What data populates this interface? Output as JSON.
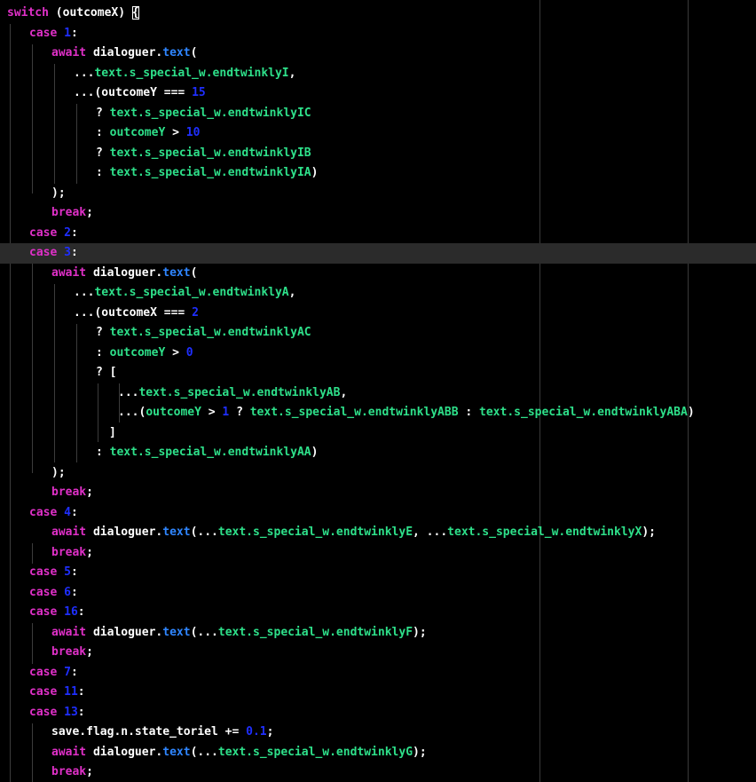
{
  "editor": {
    "current_line": 12,
    "lines": [
      {
        "indent": 0,
        "tokens": [
          {
            "t": "switch",
            "k": "kw"
          },
          {
            "t": " (outcomeX) ",
            "k": "id"
          },
          {
            "t": "{",
            "k": "op",
            "cursor": true
          }
        ]
      },
      {
        "indent": 1,
        "tokens": [
          {
            "t": "case ",
            "k": "kw"
          },
          {
            "t": "1",
            "k": "num"
          },
          {
            "t": ":",
            "k": "op"
          }
        ]
      },
      {
        "indent": 2,
        "tokens": [
          {
            "t": "await ",
            "k": "kw"
          },
          {
            "t": "dialoguer.",
            "k": "id"
          },
          {
            "t": "text",
            "k": "fn"
          },
          {
            "t": "(",
            "k": "op"
          }
        ]
      },
      {
        "indent": 3,
        "tokens": [
          {
            "t": "...",
            "k": "op"
          },
          {
            "t": "text.s_special_w.endtwinklyI",
            "k": "mem"
          },
          {
            "t": ",",
            "k": "op"
          }
        ]
      },
      {
        "indent": 3,
        "tokens": [
          {
            "t": "...(outcomeY === ",
            "k": "id"
          },
          {
            "t": "15",
            "k": "num"
          }
        ]
      },
      {
        "indent": 4,
        "tokens": [
          {
            "t": "? ",
            "k": "op"
          },
          {
            "t": "text.s_special_w.endtwinklyIC",
            "k": "mem"
          }
        ]
      },
      {
        "indent": 4,
        "tokens": [
          {
            "t": ": ",
            "k": "op"
          },
          {
            "t": "outcomeY",
            "k": "mem"
          },
          {
            "t": " > ",
            "k": "op"
          },
          {
            "t": "10",
            "k": "num"
          }
        ]
      },
      {
        "indent": 4,
        "tokens": [
          {
            "t": "? ",
            "k": "op"
          },
          {
            "t": "text.s_special_w.endtwinklyIB",
            "k": "mem"
          }
        ]
      },
      {
        "indent": 4,
        "tokens": [
          {
            "t": ": ",
            "k": "op"
          },
          {
            "t": "text.s_special_w.endtwinklyIA",
            "k": "mem"
          },
          {
            "t": ")",
            "k": "op"
          }
        ]
      },
      {
        "indent": 2,
        "tokens": [
          {
            "t": ");",
            "k": "op"
          }
        ]
      },
      {
        "indent": 2,
        "tokens": [
          {
            "t": "break",
            "k": "kw"
          },
          {
            "t": ";",
            "k": "op"
          }
        ]
      },
      {
        "indent": 1,
        "tokens": [
          {
            "t": "case ",
            "k": "kw"
          },
          {
            "t": "2",
            "k": "num"
          },
          {
            "t": ":",
            "k": "op"
          }
        ]
      },
      {
        "indent": 1,
        "tokens": [
          {
            "t": "case ",
            "k": "kw"
          },
          {
            "t": "3",
            "k": "num"
          },
          {
            "t": ":",
            "k": "op"
          }
        ]
      },
      {
        "indent": 2,
        "tokens": [
          {
            "t": "await ",
            "k": "kw"
          },
          {
            "t": "dialoguer.",
            "k": "id"
          },
          {
            "t": "text",
            "k": "fn"
          },
          {
            "t": "(",
            "k": "op"
          }
        ]
      },
      {
        "indent": 3,
        "tokens": [
          {
            "t": "...",
            "k": "op"
          },
          {
            "t": "text.s_special_w.endtwinklyA",
            "k": "mem"
          },
          {
            "t": ",",
            "k": "op"
          }
        ]
      },
      {
        "indent": 3,
        "tokens": [
          {
            "t": "...(outcomeX === ",
            "k": "id"
          },
          {
            "t": "2",
            "k": "num"
          }
        ]
      },
      {
        "indent": 4,
        "tokens": [
          {
            "t": "? ",
            "k": "op"
          },
          {
            "t": "text.s_special_w.endtwinklyAC",
            "k": "mem"
          }
        ]
      },
      {
        "indent": 4,
        "tokens": [
          {
            "t": ": ",
            "k": "op"
          },
          {
            "t": "outcomeY",
            "k": "mem"
          },
          {
            "t": " > ",
            "k": "op"
          },
          {
            "t": "0",
            "k": "num"
          }
        ]
      },
      {
        "indent": 4,
        "tokens": [
          {
            "t": "? [",
            "k": "op"
          }
        ]
      },
      {
        "indent": 5,
        "tokens": [
          {
            "t": "...",
            "k": "op"
          },
          {
            "t": "text.s_special_w.endtwinklyAB",
            "k": "mem"
          },
          {
            "t": ",",
            "k": "op"
          }
        ]
      },
      {
        "indent": 5,
        "tokens": [
          {
            "t": "...(",
            "k": "op"
          },
          {
            "t": "outcomeY",
            "k": "mem"
          },
          {
            "t": " > ",
            "k": "op"
          },
          {
            "t": "1",
            "k": "num"
          },
          {
            "t": " ? ",
            "k": "op"
          },
          {
            "t": "text.s_special_w.endtwinklyABB",
            "k": "mem"
          },
          {
            "t": " : ",
            "k": "op"
          },
          {
            "t": "text.s_special_w.endtwinklyABA",
            "k": "mem"
          },
          {
            "t": ")",
            "k": "op"
          }
        ]
      },
      {
        "indent": 4.6,
        "tokens": [
          {
            "t": "]",
            "k": "op"
          }
        ]
      },
      {
        "indent": 4,
        "tokens": [
          {
            "t": ": ",
            "k": "op"
          },
          {
            "t": "text.s_special_w.endtwinklyAA",
            "k": "mem"
          },
          {
            "t": ")",
            "k": "op"
          }
        ]
      },
      {
        "indent": 2,
        "tokens": [
          {
            "t": ");",
            "k": "op"
          }
        ]
      },
      {
        "indent": 2,
        "tokens": [
          {
            "t": "break",
            "k": "kw"
          },
          {
            "t": ";",
            "k": "op"
          }
        ]
      },
      {
        "indent": 1,
        "tokens": [
          {
            "t": "case ",
            "k": "kw"
          },
          {
            "t": "4",
            "k": "num"
          },
          {
            "t": ":",
            "k": "op"
          }
        ]
      },
      {
        "indent": 2,
        "tokens": [
          {
            "t": "await ",
            "k": "kw"
          },
          {
            "t": "dialoguer.",
            "k": "id"
          },
          {
            "t": "text",
            "k": "fn"
          },
          {
            "t": "(...",
            "k": "op"
          },
          {
            "t": "text.s_special_w.endtwinklyE",
            "k": "mem"
          },
          {
            "t": ", ...",
            "k": "op"
          },
          {
            "t": "text.s_special_w.endtwinklyX",
            "k": "mem"
          },
          {
            "t": ");",
            "k": "op"
          }
        ]
      },
      {
        "indent": 2,
        "tokens": [
          {
            "t": "break",
            "k": "kw"
          },
          {
            "t": ";",
            "k": "op"
          }
        ]
      },
      {
        "indent": 1,
        "tokens": [
          {
            "t": "case ",
            "k": "kw"
          },
          {
            "t": "5",
            "k": "num"
          },
          {
            "t": ":",
            "k": "op"
          }
        ]
      },
      {
        "indent": 1,
        "tokens": [
          {
            "t": "case ",
            "k": "kw"
          },
          {
            "t": "6",
            "k": "num"
          },
          {
            "t": ":",
            "k": "op"
          }
        ]
      },
      {
        "indent": 1,
        "tokens": [
          {
            "t": "case ",
            "k": "kw"
          },
          {
            "t": "16",
            "k": "num"
          },
          {
            "t": ":",
            "k": "op"
          }
        ]
      },
      {
        "indent": 2,
        "tokens": [
          {
            "t": "await ",
            "k": "kw"
          },
          {
            "t": "dialoguer.",
            "k": "id"
          },
          {
            "t": "text",
            "k": "fn"
          },
          {
            "t": "(...",
            "k": "op"
          },
          {
            "t": "text.s_special_w.endtwinklyF",
            "k": "mem"
          },
          {
            "t": ");",
            "k": "op"
          }
        ]
      },
      {
        "indent": 2,
        "tokens": [
          {
            "t": "break",
            "k": "kw"
          },
          {
            "t": ";",
            "k": "op"
          }
        ]
      },
      {
        "indent": 1,
        "tokens": [
          {
            "t": "case ",
            "k": "kw"
          },
          {
            "t": "7",
            "k": "num"
          },
          {
            "t": ":",
            "k": "op"
          }
        ]
      },
      {
        "indent": 1,
        "tokens": [
          {
            "t": "case ",
            "k": "kw"
          },
          {
            "t": "11",
            "k": "num"
          },
          {
            "t": ":",
            "k": "op"
          }
        ]
      },
      {
        "indent": 1,
        "tokens": [
          {
            "t": "case ",
            "k": "kw"
          },
          {
            "t": "13",
            "k": "num"
          },
          {
            "t": ":",
            "k": "op"
          }
        ]
      },
      {
        "indent": 2,
        "tokens": [
          {
            "t": "save.flag.n.state_toriel",
            "k": "id"
          },
          {
            "t": " += ",
            "k": "op"
          },
          {
            "t": "0.1",
            "k": "num"
          },
          {
            "t": ";",
            "k": "op"
          }
        ]
      },
      {
        "indent": 2,
        "tokens": [
          {
            "t": "await ",
            "k": "kw"
          },
          {
            "t": "dialoguer.",
            "k": "id"
          },
          {
            "t": "text",
            "k": "fn"
          },
          {
            "t": "(...",
            "k": "op"
          },
          {
            "t": "text.s_special_w.endtwinklyG",
            "k": "mem"
          },
          {
            "t": ");",
            "k": "op"
          }
        ]
      },
      {
        "indent": 2,
        "tokens": [
          {
            "t": "break",
            "k": "kw"
          },
          {
            "t": ";",
            "k": "op"
          }
        ]
      }
    ]
  }
}
